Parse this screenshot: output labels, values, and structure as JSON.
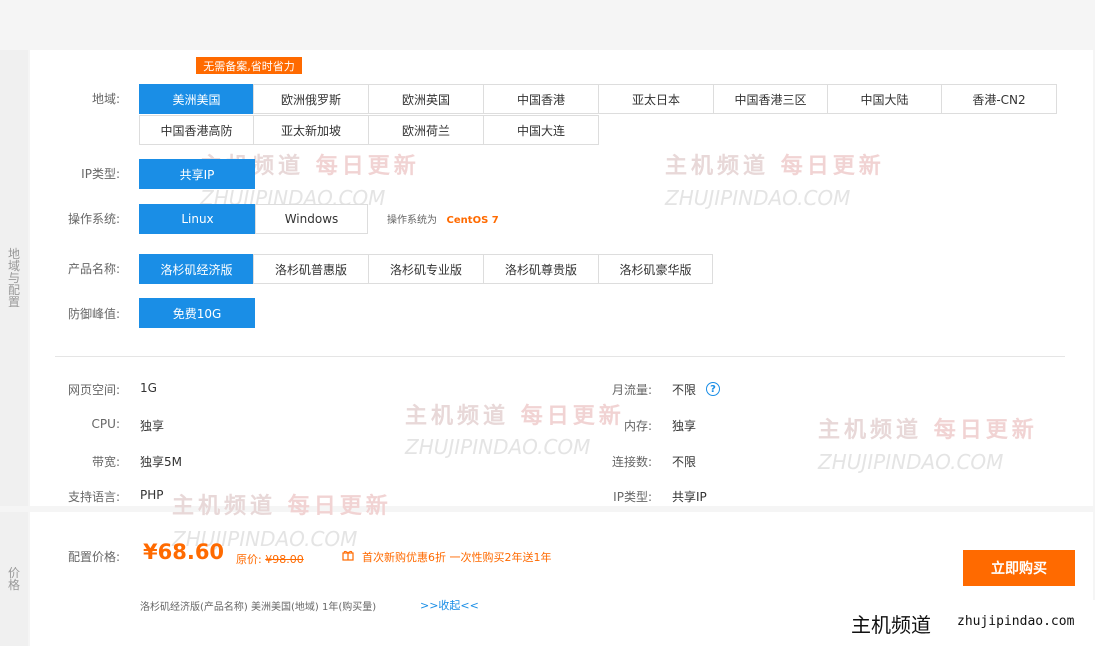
{
  "tag": "无需备案,省时省力",
  "side": {
    "config": "地域与配置",
    "price": "价格"
  },
  "region": {
    "label": "地域:",
    "options": [
      "美洲美国",
      "欧洲俄罗斯",
      "欧洲英国",
      "中国香港",
      "亚太日本",
      "中国香港三区",
      "中国大陆",
      "香港-CN2",
      "中国香港高防",
      "亚太新加坡",
      "欧洲荷兰",
      "中国大连"
    ]
  },
  "ip": {
    "label": "IP类型:",
    "options": [
      "共享IP"
    ]
  },
  "os": {
    "label": "操作系统:",
    "options": [
      "Linux",
      "Windows"
    ],
    "note_prefix": "操作系统为",
    "note_value": "CentOS 7"
  },
  "product": {
    "label": "产品名称:",
    "options": [
      "洛杉矶经济版",
      "洛杉矶普惠版",
      "洛杉矶专业版",
      "洛杉矶尊贵版",
      "洛杉矶豪华版"
    ]
  },
  "ddos": {
    "label": "防御峰值:",
    "options": [
      "免费10G"
    ]
  },
  "specs": {
    "left": [
      {
        "label": "网页空间:",
        "value": "1G"
      },
      {
        "label": "CPU:",
        "value": "独享"
      },
      {
        "label": "带宽:",
        "value": "独享5M"
      },
      {
        "label": "支持语言:",
        "value": "PHP"
      }
    ],
    "right": [
      {
        "label": "月流量:",
        "value": "不限"
      },
      {
        "label": "内存:",
        "value": "独享"
      },
      {
        "label": "连接数:",
        "value": "不限"
      },
      {
        "label": "IP类型:",
        "value": "共享IP"
      }
    ]
  },
  "price": {
    "label": "配置价格:",
    "amount": "¥68.60",
    "orig_label": "原价:",
    "orig_value": "¥98.00",
    "promo": "首次新购优惠6折 一次性购买2年送1年",
    "summary": "洛杉矶经济版(产品名称)  美洲美国(地域)  1年(购买量)",
    "collapse": ">>收起<<",
    "buy": "立即购买"
  },
  "watermark": {
    "cn_a": "主机频道",
    "cn_b": "每日更新",
    "en": "ZHUJIPINDAO.COM"
  },
  "brand": {
    "cn": "主机频道",
    "url": "zhujipindao.com"
  },
  "colors": {
    "accent": "#1a8ee6",
    "orange": "#ff6a00"
  }
}
